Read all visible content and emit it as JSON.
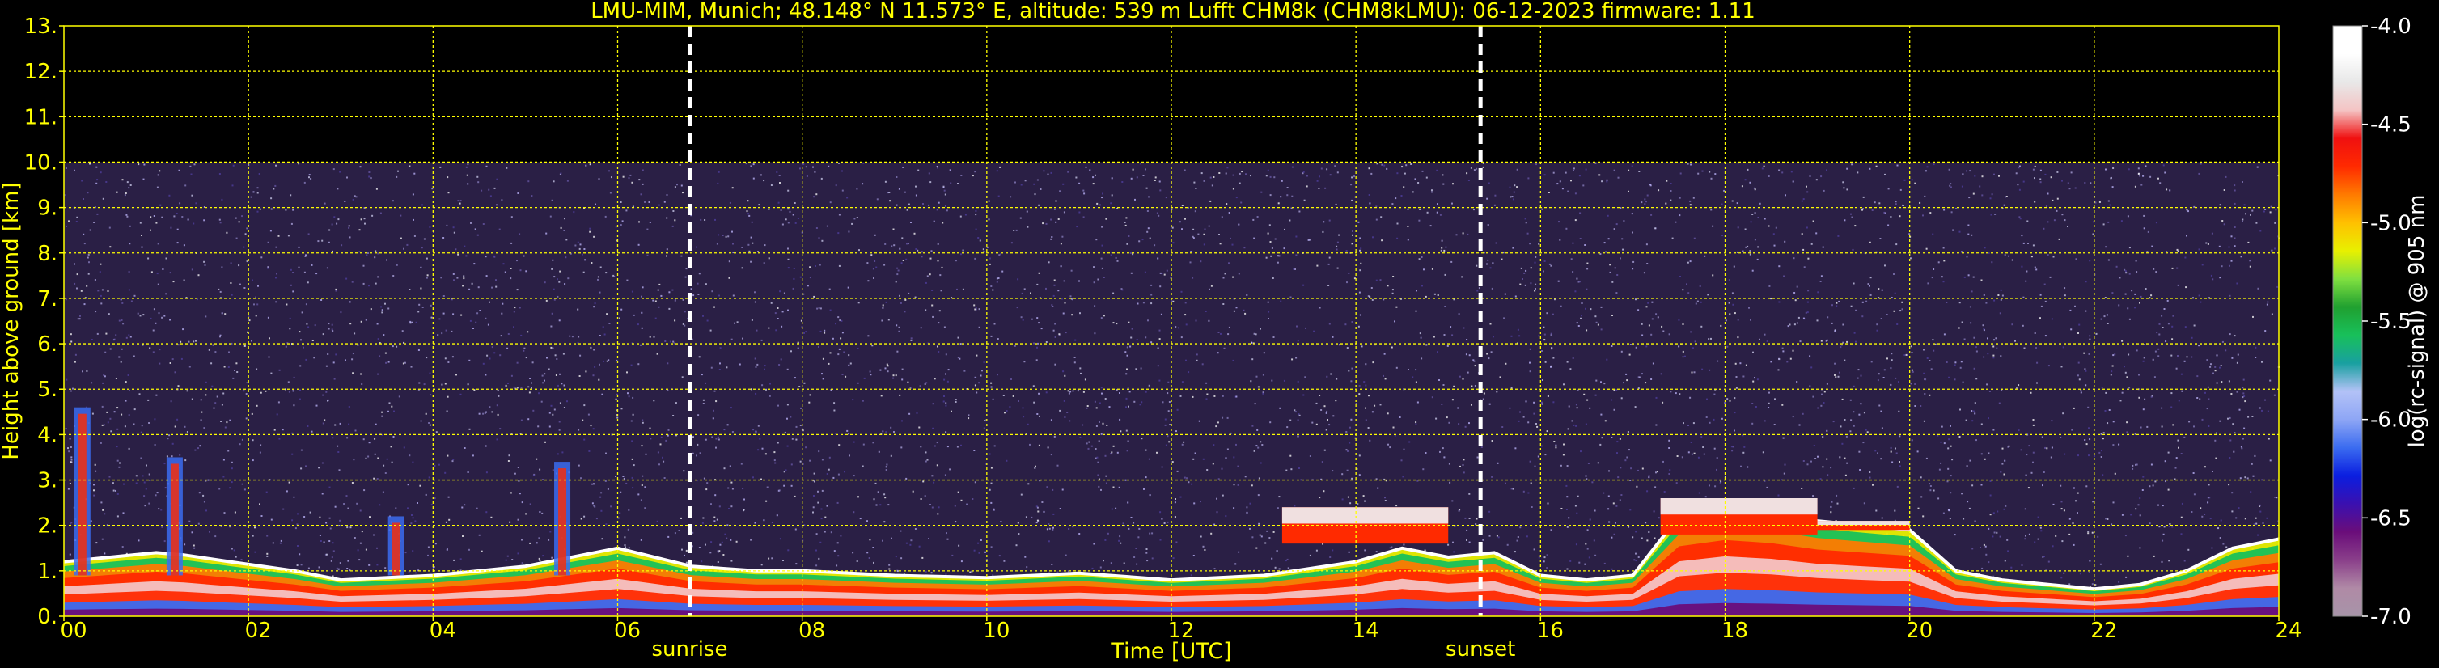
{
  "chart_data": {
    "type": "heatmap",
    "title": "LMU-MIM, Munich; 48.148° N 11.573° E, altitude: 539 m    Lufft CHM8k (CHM8kLMU): 06-12-2023    firmware: 1.11",
    "xlabel": "Time [UTC]",
    "ylabel": "Height above ground [km]",
    "xlim": [
      0,
      24
    ],
    "ylim": [
      0,
      13
    ],
    "x_ticks": [
      "00",
      "02",
      "04",
      "06",
      "08",
      "10",
      "12",
      "14",
      "16",
      "18",
      "20",
      "22",
      "24"
    ],
    "y_ticks": [
      "0.",
      "1.",
      "2.",
      "3.",
      "4.",
      "5.",
      "6.",
      "7.",
      "8.",
      "9.",
      "10.",
      "11.",
      "12.",
      "13."
    ],
    "grid": true,
    "annotations": [
      {
        "label": "sunrise",
        "x": 6.78
      },
      {
        "label": "sunset",
        "x": 15.35
      }
    ],
    "colorbar": {
      "label": "log(rc-signal) @ 905 nm",
      "ticks": [
        "-4.0",
        "-4.5",
        "-5.0",
        "-5.5",
        "-6.0",
        "-6.5",
        "-7.0"
      ],
      "tick_values": [
        -4.0,
        -4.5,
        -5.0,
        -5.5,
        -6.0,
        -6.5,
        -7.0
      ],
      "range": [
        -7.0,
        -4.0
      ],
      "stops": [
        "#a794a8",
        "#b08aa6",
        "#8a3f8a",
        "#6a0d7a",
        "#3a10b0",
        "#0a1ee0",
        "#3b6cf0",
        "#8ea6f5",
        "#b3c2f7",
        "#18a0a0",
        "#18c05a",
        "#20a030",
        "#80e040",
        "#e8f000",
        "#ffc000",
        "#ff7a00",
        "#ff2a00",
        "#f01010",
        "#f4c4c4",
        "#e8e8e8",
        "#ffffff",
        "#ffffff"
      ]
    },
    "data_extent_km": 10.0,
    "boundary_layer": {
      "x": [
        0,
        0.5,
        1.0,
        1.3,
        1.8,
        2.5,
        3.0,
        4.0,
        5.0,
        6.0,
        6.8,
        7.5,
        8.0,
        9.0,
        10.0,
        11.0,
        12.0,
        13.0,
        14.0,
        14.5,
        15.0,
        15.5,
        16.0,
        16.5,
        17.0,
        17.5,
        18.0,
        18.5,
        19.0,
        19.5,
        20.0,
        20.5,
        21.0,
        21.5,
        22.0,
        22.5,
        23.0,
        23.5,
        24.0
      ],
      "y": [
        1.2,
        1.3,
        1.4,
        1.35,
        1.2,
        1.0,
        0.8,
        0.9,
        1.1,
        1.5,
        1.1,
        1.0,
        1.0,
        0.9,
        0.85,
        0.95,
        0.8,
        0.9,
        1.2,
        1.5,
        1.3,
        1.4,
        0.9,
        0.8,
        0.9,
        2.2,
        2.4,
        2.3,
        2.1,
        2.0,
        1.9,
        1.0,
        0.8,
        0.7,
        0.6,
        0.7,
        1.0,
        1.5,
        1.7
      ]
    },
    "cloud_layers": [
      {
        "x_start": 13.2,
        "x_end": 15.0,
        "top": 2.4,
        "base": 1.6
      },
      {
        "x_start": 17.3,
        "x_end": 19.0,
        "top": 2.6,
        "base": 1.8
      },
      {
        "x_start": 19.0,
        "x_end": 20.0,
        "top": 2.1,
        "base": 1.9
      }
    ],
    "plumes": [
      {
        "x": 1.2,
        "top": 3.5
      },
      {
        "x": 3.6,
        "top": 2.2
      },
      {
        "x": 5.4,
        "top": 3.4
      },
      {
        "x": 0.2,
        "top": 4.6
      }
    ]
  }
}
